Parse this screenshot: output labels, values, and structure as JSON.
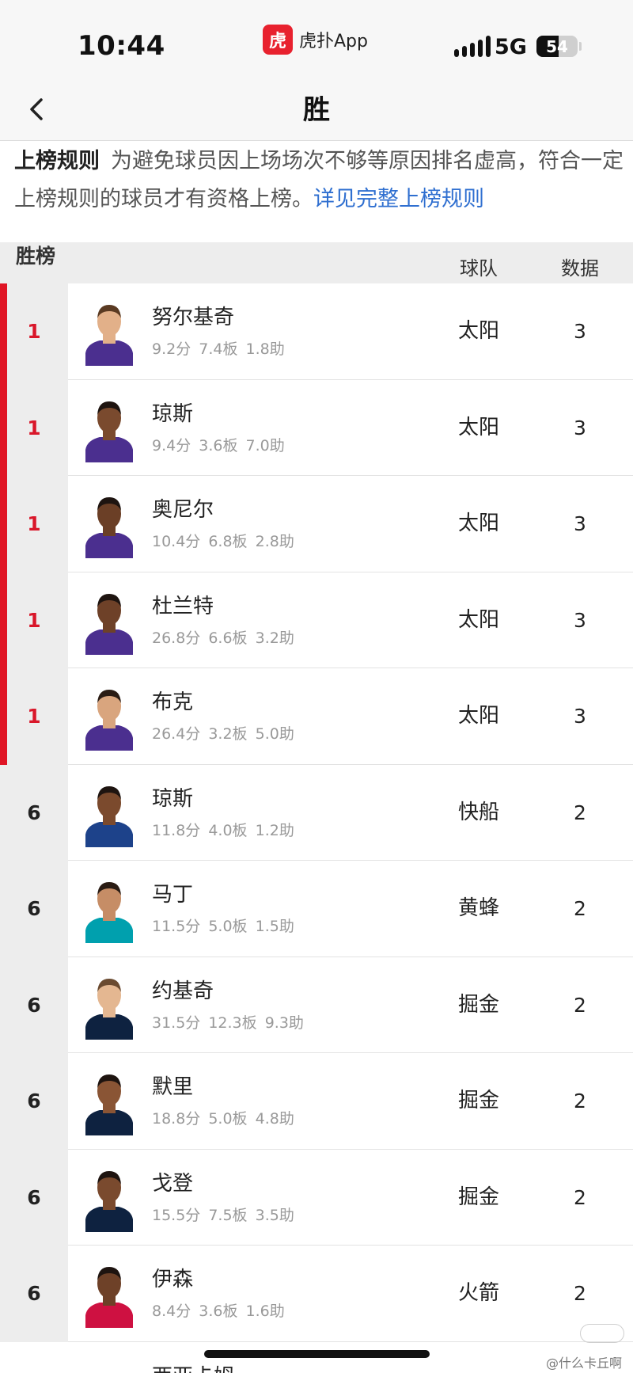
{
  "status_bar": {
    "time": "10:44",
    "app_logo_glyph": "虎",
    "app_name": "虎扑App",
    "network": "5G",
    "battery": "54",
    "battery_level": 0.54
  },
  "nav": {
    "title": "胜",
    "back_icon": "chevron-left-icon"
  },
  "rules": {
    "title": "上榜规则",
    "text": "为避免球员因上场场次不够等原因排名虚高，符合一定上榜规则的球员才有资格上榜。",
    "link": "详见完整上榜规则"
  },
  "table": {
    "header": {
      "rank": "胜榜",
      "team": "球队",
      "data": "数据"
    },
    "rows": [
      {
        "rank": "1",
        "name": "努尔基奇",
        "stats": "9.2分 7.4板 1.8助",
        "team": "太阳",
        "value": "3",
        "jersey": "#4b2f8f",
        "skin": "#e2b089",
        "hair": "#5a3a22"
      },
      {
        "rank": "1",
        "name": "琼斯",
        "stats": "9.4分 3.6板 7.0助",
        "team": "太阳",
        "value": "3",
        "jersey": "#4b2f8f",
        "skin": "#7a4a2e",
        "hair": "#1e1410"
      },
      {
        "rank": "1",
        "name": "奥尼尔",
        "stats": "10.4分 6.8板 2.8助",
        "team": "太阳",
        "value": "3",
        "jersey": "#4b2f8f",
        "skin": "#6b3f26",
        "hair": "#1e1410"
      },
      {
        "rank": "1",
        "name": "杜兰特",
        "stats": "26.8分 6.6板 3.2助",
        "team": "太阳",
        "value": "3",
        "jersey": "#4b2f8f",
        "skin": "#6e4128",
        "hair": "#1e1410"
      },
      {
        "rank": "1",
        "name": "布克",
        "stats": "26.4分 3.2板 5.0助",
        "team": "太阳",
        "value": "3",
        "jersey": "#4b2f8f",
        "skin": "#d9a57e",
        "hair": "#2a1c14"
      },
      {
        "rank": "6",
        "name": "琼斯",
        "stats": "11.8分 4.0板 1.2助",
        "team": "快船",
        "value": "2",
        "jersey": "#1d428a",
        "skin": "#7b4a2d",
        "hair": "#1e1410"
      },
      {
        "rank": "6",
        "name": "马丁",
        "stats": "11.5分 5.0板 1.5助",
        "team": "黄蜂",
        "value": "2",
        "jersey": "#00a0ae",
        "skin": "#c68d66",
        "hair": "#2a1c14"
      },
      {
        "rank": "6",
        "name": "约基奇",
        "stats": "31.5分 12.3板 9.3助",
        "team": "掘金",
        "value": "2",
        "jersey": "#0e2240",
        "skin": "#e4b791",
        "hair": "#6a4a30"
      },
      {
        "rank": "6",
        "name": "默里",
        "stats": "18.8分 5.0板 4.8助",
        "team": "掘金",
        "value": "2",
        "jersey": "#0e2240",
        "skin": "#8a5535",
        "hair": "#1e1410"
      },
      {
        "rank": "6",
        "name": "戈登",
        "stats": "15.5分 7.5板 3.5助",
        "team": "掘金",
        "value": "2",
        "jersey": "#0e2240",
        "skin": "#7a4a2e",
        "hair": "#1e1410"
      },
      {
        "rank": "6",
        "name": "伊森",
        "stats": "8.4分 3.6板 1.6助",
        "team": "火箭",
        "value": "2",
        "jersey": "#ce1141",
        "skin": "#6e4128",
        "hair": "#1e1410"
      }
    ]
  },
  "partial_row_name": "西亚卡姆",
  "watermark": "@什么卡丘啊",
  "colors": {
    "accent": "#e01525",
    "link": "#2f6fd0"
  }
}
